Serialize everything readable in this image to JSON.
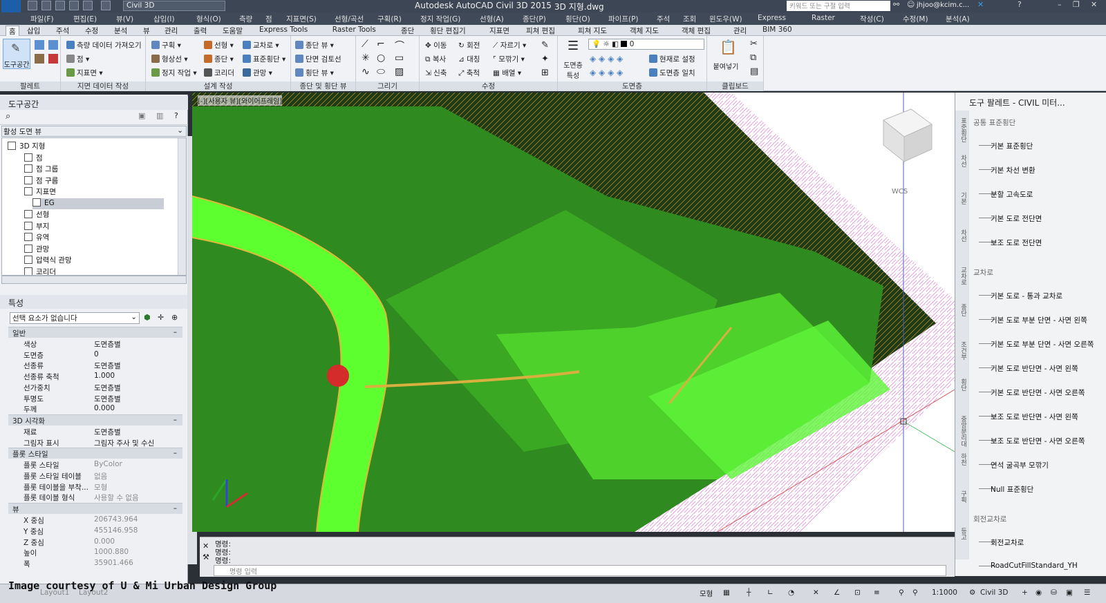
{
  "title_bar": {
    "app_title": "Autodesk AutoCAD Civil 3D 2015",
    "file_name": "3D 지형.dwg",
    "workspace": "Civil 3D",
    "search_placeholder": "키워드 또는 구절 입력",
    "user": "jhjoo@kcim.c..."
  },
  "menu": [
    "파일(F)",
    "편집(E)",
    "뷰(V)",
    "삽입(I)",
    "형식(O)",
    "측량",
    "점",
    "지표면(S)",
    "선형/곡선",
    "구획(R)",
    "정지 작업(G)",
    "선형(A)",
    "종단(P)",
    "횡단(O)",
    "파이프(P)",
    "주석",
    "조회",
    "윈도우(W)",
    "Express",
    "Raster",
    "작성(C)",
    "수정(M)",
    "분석(A)"
  ],
  "ribbon_tabs": [
    "홈",
    "삽입",
    "주석",
    "수정",
    "분석",
    "뷰",
    "관리",
    "출력",
    "도움말",
    "Express Tools",
    "Raster Tools",
    "종단",
    "횡단 편집기",
    "지표면",
    "피쳐 편집",
    "피쳐 지도",
    "객체 지도",
    "객체 편집",
    "관리",
    "BIM 360"
  ],
  "ribbon_groups": [
    "팔레트",
    "지면 데이터 작성",
    "설계 작성",
    "종단 및 횡단 뷰",
    "그리기",
    "수정",
    "도면층",
    "클립보드"
  ],
  "ribbon_buttons": {
    "toolspace": "도구공간",
    "survey": "측량 데이터 가져오기",
    "points": "점",
    "surfaces": "지표면",
    "parcel": "구획",
    "alignment": "선형",
    "intersections": "교차로",
    "profile": "종단",
    "feature_line": "형상선",
    "assembly": "표준횡단",
    "grading": "정지 작업",
    "corridor": "코리더",
    "pipe": "관망",
    "profile_view": "종단 뷰",
    "section_review": "단면 검토선",
    "section_view": "횡단 뷰",
    "move": "이동",
    "rotate": "회전",
    "trim": "자르기",
    "copy": "복사",
    "mirror": "대칭",
    "fillet": "모깎기",
    "stretch": "신축",
    "scale": "축척",
    "array": "배열",
    "layer_props": "도면층 특성",
    "set_current": "현재로 설정",
    "match_layer": "도면층 일치",
    "paste": "붙여넣기",
    "layer_value": "0"
  },
  "toolspace": {
    "header": "도구공간",
    "view": "활성 도면 뷰",
    "tree": [
      {
        "label": "3D 지형",
        "level": 0
      },
      {
        "label": "점",
        "level": 2
      },
      {
        "label": "점 그룹",
        "level": 2
      },
      {
        "label": "점 구름",
        "level": 2
      },
      {
        "label": "지표면",
        "level": 2
      },
      {
        "label": "EG",
        "level": 3
      },
      {
        "label": "선형",
        "level": 2
      },
      {
        "label": "부지",
        "level": 2
      },
      {
        "label": "유역",
        "level": 2
      },
      {
        "label": "관망",
        "level": 2
      },
      {
        "label": "압력식 관망",
        "level": 2
      },
      {
        "label": "코리더",
        "level": 2
      }
    ]
  },
  "properties": {
    "header": "특성",
    "selection": "선택 요소가 없습니다",
    "sections": [
      {
        "name": "일반",
        "rows": [
          [
            "색상",
            "도면층별"
          ],
          [
            "도면층",
            "0"
          ],
          [
            "선종류",
            "도면층별"
          ],
          [
            "선종류 축척",
            "1.000"
          ],
          [
            "선가중치",
            "도면층별"
          ],
          [
            "투명도",
            "도면층별"
          ],
          [
            "두께",
            "0.000"
          ]
        ]
      },
      {
        "name": "3D 시각화",
        "rows": [
          [
            "재료",
            "도면층별"
          ],
          [
            "그림자 표시",
            "그림자 주사 및 수신"
          ]
        ]
      },
      {
        "name": "플롯 스타일",
        "rows": [
          [
            "플롯 스타일",
            "ByColor"
          ],
          [
            "플롯 스타일 테이블",
            "없음"
          ],
          [
            "플롯 테이블을 부착...",
            "모형"
          ],
          [
            "플롯 테이블 형식",
            "사용할 수 없음"
          ]
        ]
      },
      {
        "name": "뷰",
        "rows": [
          [
            "X 중심",
            "206743.964"
          ],
          [
            "Y 중심",
            "455146.958"
          ],
          [
            "Z 중심",
            "0.000"
          ],
          [
            "높이",
            "1000.880"
          ],
          [
            "폭",
            "35901.466"
          ]
        ]
      }
    ]
  },
  "viewport": {
    "label": "[-][사용자 뷰][와이어프레임]",
    "wcs": "WCS"
  },
  "command": {
    "lines": [
      "명령:",
      "명령:",
      "명령:"
    ],
    "placeholder": "명령 입력"
  },
  "palette": {
    "title": "도구 팔레트 - CIVIL 미터...",
    "side_tabs": [
      "표준횡단",
      "차선",
      "기본",
      "차선",
      "교차로",
      "종단",
      "조건부",
      "횡단",
      "중앙분리대",
      "하천",
      "구획",
      "등고"
    ],
    "groups": [
      {
        "name": "공통 표준횡단",
        "items": [
          "기본 표준횡단",
          "기본 차선 변환",
          "분할 고속도로",
          "기본 도로 전단면",
          "보조 도로 전단면"
        ]
      },
      {
        "name": "교차로",
        "items": [
          "기본 도로 - 통과 교차로",
          "기본 도로 부분 단면 - 사면 왼쪽",
          "기본 도로 부분 단면 - 사면 오른쪽",
          "기본 도로 반단면 - 사면 왼쪽",
          "기본 도로 반단면 - 사면 오른쪽",
          "보조 도로 반단면 - 사면 왼쪽",
          "보조 도로 반단면 - 사면 오른쪽",
          "연석 굴곡부 모깎기",
          "Null 표준횡단"
        ]
      },
      {
        "name": "회전교차로",
        "items": [
          "회전교차로",
          "RoadCutFillStandard_YH"
        ]
      }
    ]
  },
  "statusbar": {
    "model": "모형",
    "scale": "1:1000",
    "workspace": "Civil 3D",
    "layout_tabs": [
      "Layout1",
      "Layout2"
    ]
  },
  "credit": "Image courtesy of U & Mi Urban Design Group"
}
